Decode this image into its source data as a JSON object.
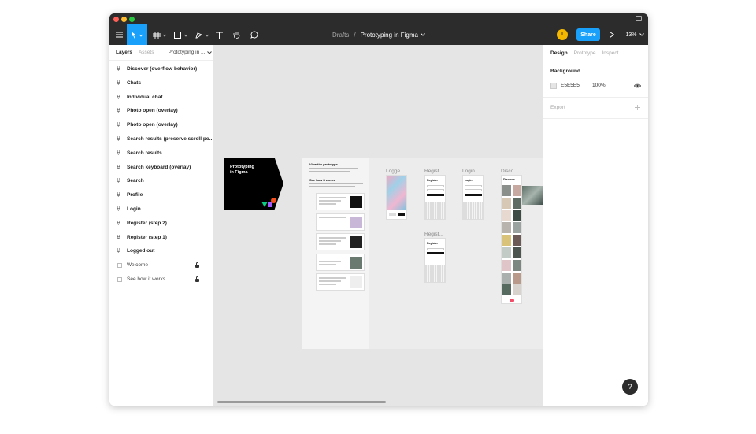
{
  "breadcrumb": {
    "folder": "Drafts",
    "separator": "/",
    "file": "Prototyping in Figma"
  },
  "toolbar": {
    "share_label": "Share",
    "zoom": "13%"
  },
  "left_panel": {
    "tabs": [
      "Layers",
      "Assets"
    ],
    "page": "Prototyping in ...",
    "layers": [
      {
        "name": "Discover (overflow behavior)",
        "kind": "frame"
      },
      {
        "name": "Chats",
        "kind": "frame"
      },
      {
        "name": "Individual chat",
        "kind": "frame"
      },
      {
        "name": "Photo open (overlay)",
        "kind": "frame"
      },
      {
        "name": "Photo open (overlay)",
        "kind": "frame"
      },
      {
        "name": "Search results (preserve scroll po...",
        "kind": "frame"
      },
      {
        "name": "Search results",
        "kind": "frame"
      },
      {
        "name": "Search keyboard (overlay)",
        "kind": "frame"
      },
      {
        "name": "Search",
        "kind": "frame"
      },
      {
        "name": "Profile",
        "kind": "frame"
      },
      {
        "name": "Login",
        "kind": "frame"
      },
      {
        "name": "Register (step 2)",
        "kind": "frame"
      },
      {
        "name": "Register (step 1)",
        "kind": "frame"
      },
      {
        "name": "Logged out",
        "kind": "frame"
      },
      {
        "name": "Welcome",
        "kind": "locked"
      },
      {
        "name": "See how it works",
        "kind": "locked"
      }
    ]
  },
  "right_panel": {
    "tabs": [
      "Design",
      "Prototype",
      "Inspect"
    ],
    "background_label": "Background",
    "background_hex": "E5E5E5",
    "background_opacity": "100%",
    "export_label": "Export"
  },
  "canvas": {
    "cover_title_line1": "Prototyping",
    "cover_title_line2": "in Figma",
    "doc_heading": "View the prototype",
    "doc_subheading": "See how it works",
    "frame_labels": [
      "Logge...",
      "Regist...",
      "Login",
      "Disco...",
      "Regist..."
    ],
    "register_label": "Register",
    "login_label": "Login",
    "discover_label": "Discover"
  },
  "colors": {
    "toolbar": "#2c2c2c",
    "accent": "#18a0fb",
    "canvas": "#e5e5e5",
    "avatar": "#f5b800"
  }
}
